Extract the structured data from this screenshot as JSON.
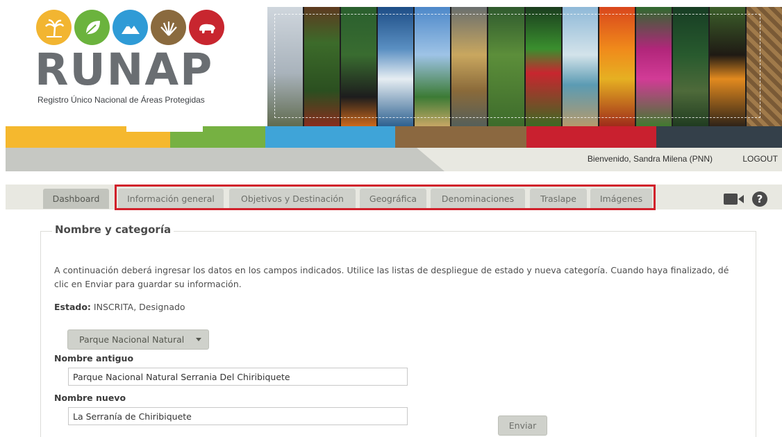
{
  "logo": {
    "wordmark": "RUNAP",
    "subtitle": "Registro Único Nacional de Áreas Protegidas",
    "circles": [
      {
        "icon": "palm-tree-icon",
        "color": "#f2b531"
      },
      {
        "icon": "leaf-icon",
        "color": "#6bb33d"
      },
      {
        "icon": "mountain-icon",
        "color": "#2f9bd6"
      },
      {
        "icon": "grass-icon",
        "color": "#8a6a3e"
      },
      {
        "icon": "animal-icon",
        "color": "#c8262f"
      }
    ]
  },
  "colorband": [
    "#f5b82e",
    "#76b142",
    "#3fa4d8",
    "#8b6840",
    "#c9202f",
    "#34404a"
  ],
  "userbar": {
    "welcome": "Bienvenido, Sandra Milena (PNN)",
    "logout": "LOGOUT"
  },
  "tabs": [
    {
      "label": "Dashboard"
    },
    {
      "label": "Información general"
    },
    {
      "label": "Objetivos y Destinación"
    },
    {
      "label": "Geográfica"
    },
    {
      "label": "Denominaciones"
    },
    {
      "label": "Traslape"
    },
    {
      "label": "Imágenes"
    }
  ],
  "toolbar_icons": [
    "video-camera-icon",
    "help-icon"
  ],
  "form": {
    "legend": "Nombre y categoría",
    "intro": "A continuación deberá ingresar los datos en los campos indicados. Utilice las listas de despliegue de estado y nueva categoría. Cuando haya finalizado, dé clic en Enviar para guardar su información.",
    "estado_label": "Estado:",
    "estado_value": "INSCRITA, Designado",
    "categoria_selected": "Parque Nacional Natural",
    "nombre_antiguo_label": "Nombre antiguo",
    "nombre_antiguo_value": "Parque Nacional Natural Serrania Del Chiribiquete",
    "nombre_nuevo_label": "Nombre nuevo",
    "nombre_nuevo_value": "La Serranía de Chiribiquete",
    "submit_label": "Enviar"
  }
}
